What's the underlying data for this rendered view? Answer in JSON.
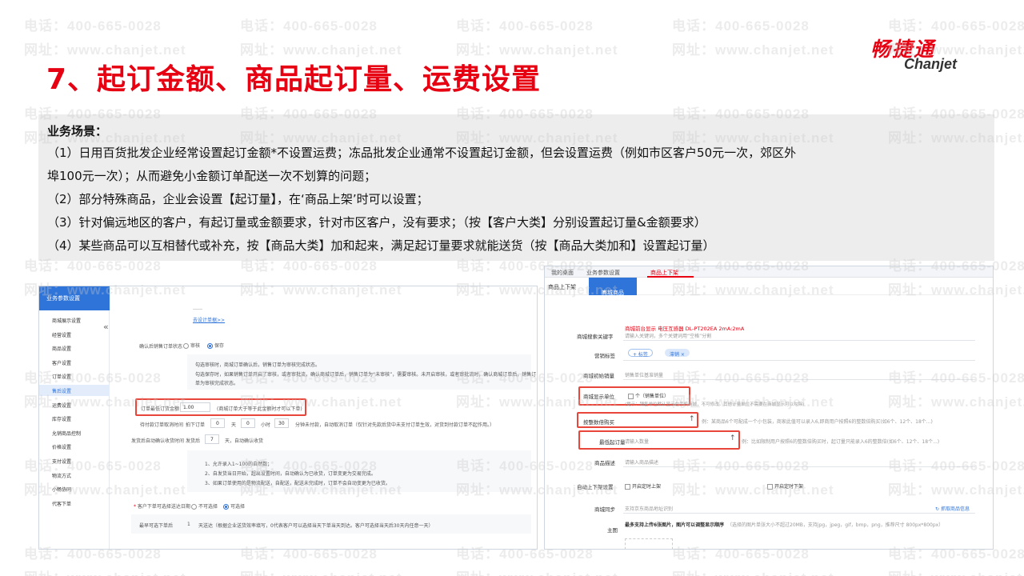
{
  "watermark": {
    "phone": "电话：400-665-0028",
    "site": "网址：www.chanjet.net"
  },
  "header": {
    "title": "7、起订金额、商品起订量、运费设置"
  },
  "logo": {
    "cn": "畅捷通",
    "en": "Chanjet"
  },
  "scenario": {
    "heading": "业务场景：",
    "lines": [
      "（1）日用百货批发企业经常设置起订金额*不设置运费；冻品批发企业通常不设置起订金额，但会设置运费（例如市区客户50元一次，郊区外",
      "埠100元一次）；从而避免小金额订单配送一次不划算的问题；",
      "（2）部分特殊商品，企业会设置【起订量】，在‘商品上架’时可以设置；",
      "（3）针对偏远地区的客户，有起订量或金额要求，针对市区客户，没有要求；（按【客户大类】分别设置起订量&金额要求）",
      "（4）某些商品可以互相替代或补充，按【商品大类】加和起来，满足起订量要求就能送货（按【商品大类加和】设置起订量）"
    ]
  },
  "left_screen": {
    "header": "业务参数设置",
    "collapse": "«",
    "sidebar": [
      "商城展示设置",
      "经营设置",
      "商品设置",
      "客户设置",
      "订单设置",
      "售后设置",
      "运费设置",
      "库存设置",
      "允销商品控制",
      "价格设置",
      "支付设置",
      "物流方式",
      "小畅协同",
      "代客下单"
    ],
    "active_item": "售后设置",
    "top_link": "去设计单据>>",
    "top_dots": "……",
    "confirm_label": "确认后销售订单状态",
    "confirm_opt1": "审核",
    "confirm_opt2": "保存",
    "hint1": "勾选审核时，商城订单确认后，销售订单为审核完成状态。",
    "hint2": "勾选保存时，如果销售订单开启了审核，或者审批流，确认商城订单后，销售订单为“未审核”，需要审核。未开启审核，或者审批流时，确认商城订单后，销售订",
    "hint3": "单为审核完成状态。",
    "min_amount_label": "订单最低订货金额",
    "min_amount_value": "1.00",
    "min_amount_note": "(商城订单大于等于此金额时才可以下单)",
    "cancel_label": "待付款订单取消时间",
    "cancel_prefix": "拍下订单",
    "cancel_d": "0",
    "cancel_d_unit": "天",
    "cancel_h": "0",
    "cancel_h_unit": "小时",
    "cancel_m": "30",
    "cancel_note": "分钟未付款，自动取消订单（仅针对先款后货中未支付订单生效，对货到付款订单不起作用。）",
    "auto_confirm_label": "发货后自动确认收货时间",
    "auto_confirm_prefix": "发货后",
    "auto_confirm_days": "7",
    "auto_confirm_suffix": "天，自动确认收货",
    "rules": [
      "1、允许录入1~100的自然数；",
      "2、自发货当日开始，超出设置时间，自动确认为已收货，订单变更为交易完成。",
      "3、如果订单使用的是物流配送，自配送，配送未完成时，订单不会自动变更为已收货。"
    ],
    "delivery_label": "客户下单可选择送达日期",
    "delivery_opt1": "不可选择",
    "delivery_opt2": "可选择",
    "earliest_label": "最早可选下单后",
    "earliest_value": "1",
    "earliest_note": "天送达（根据企业送货效率填写，0代表客户可以选择当天下单当天到达。客户可选择当天后30天内任意一天）"
  },
  "right_screen": {
    "tabs": [
      "我的桌面",
      "业务参数设置",
      "商品上下架"
    ],
    "active_tab": "商品上下架",
    "subtab_left": "商品上下架",
    "subtab_active": "商城商品",
    "subtab_close": "×",
    "product_name": "商城前台显示 电压互感器 DL-PT202EA 2mA:2mA",
    "fields": {
      "search_kw_label": "商城搜索关键字",
      "search_kw_placeholder": "请输入关键词，多个关键词用“空格”分割",
      "tag_label": "营销标签",
      "tag_add": "+ 标签",
      "tag_value": "滞销 ×",
      "init_sales_label": "商城初始销量",
      "init_sales_placeholder": "销售单位基准销量",
      "unit_label": "商城显示单位",
      "unit_value": "个（销售单位）",
      "unit_hint": "(提示：销售单位默认显示在手机商城，不可修改。其他计量单位不需要在商城显示可以勾除)",
      "multiple_label": "按整数倍购买",
      "multiple_note": "例：某商品6个可配成一个小包装，商家此值可以录入6,即商用户按照6的整数倍购买(如6个、12个、18个...)",
      "min_qty_label": "最低起订量",
      "min_qty_placeholder": "请输入数量",
      "min_qty_note": "例：比如限制用户按照6的整数倍购买时，起订量只能录入6的整数倍(如6个、12个、18个...)",
      "desc_label": "商品描述",
      "desc_placeholder": "请输入商品描述",
      "auto_shelf_label": "自动上下架设置",
      "auto_on": "开启定时上架",
      "auto_off": "开启定时下架",
      "sync_label": "商城同步",
      "sync_placeholder": "支持京东商品地址识别",
      "sync_button": "抓取商品信息",
      "image_label": "主图",
      "image_note": "最多支持上传6张图片，图片可以调整显示顺序",
      "image_spec": "（选择的图片单张大小不超过20MB，支持jpg，jpeg，gif，bmp，png，推荐尺寸 800px*800px）"
    }
  }
}
